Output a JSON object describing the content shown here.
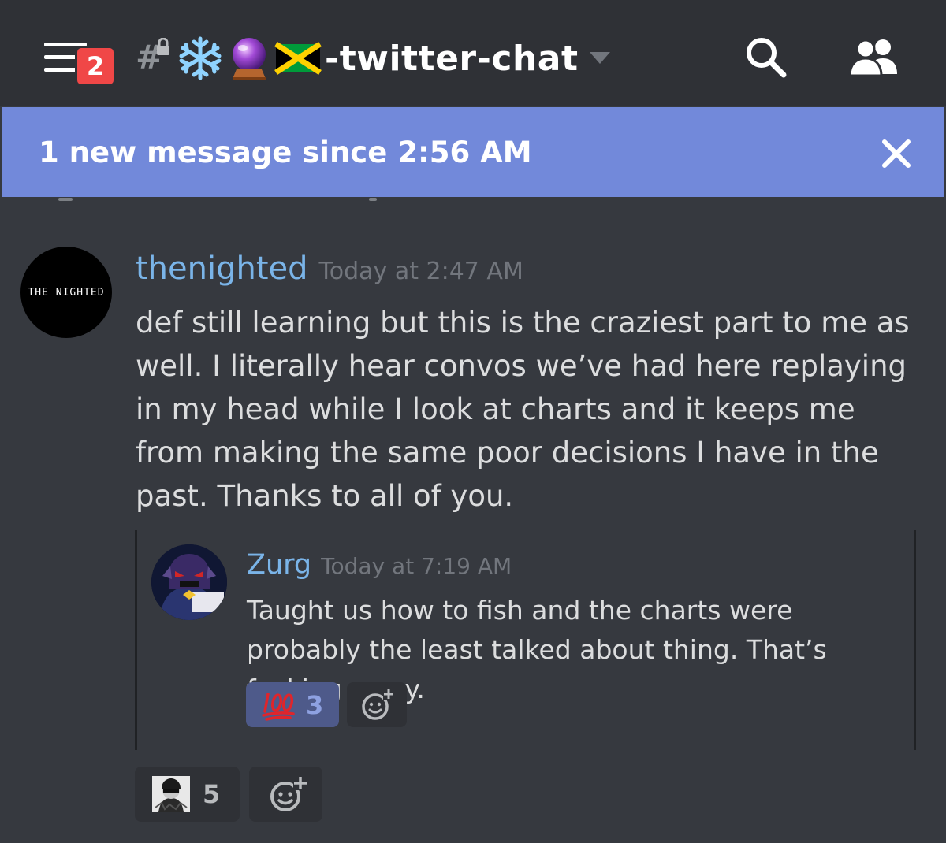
{
  "header": {
    "menu_badge": "2",
    "channel_name": "-twitter-chat",
    "channel_emojis": [
      "snowflake",
      "crystal-ball",
      "flag-jamaica"
    ]
  },
  "banner": {
    "text": "1 new message since 2:56 AM"
  },
  "message": {
    "author": "thenighted",
    "avatar_text": "THE NIGHTED",
    "timestamp": "Today at 2:47 AM",
    "body": "def still learning but this is the craziest part to me as well. I literally hear convos we’ve had here replaying in my head while I look at charts and it keeps me from making the same poor decisions I have in the past. Thanks to all of you.",
    "reactions": [
      {
        "emoji": "custom-avatar",
        "count": "5"
      }
    ]
  },
  "reply": {
    "author": "Zurg",
    "timestamp": "Today at 7:19 AM",
    "body": "Taught us how to fish and the charts were probably the least talked about thing. That’s fucking crazy.",
    "reactions": [
      {
        "emoji": "100",
        "count": "3"
      }
    ]
  },
  "colors": {
    "background": "#36393f",
    "header": "#2f3136",
    "banner": "#7289da",
    "username": "#7ab4e8",
    "badge": "#f04747"
  }
}
